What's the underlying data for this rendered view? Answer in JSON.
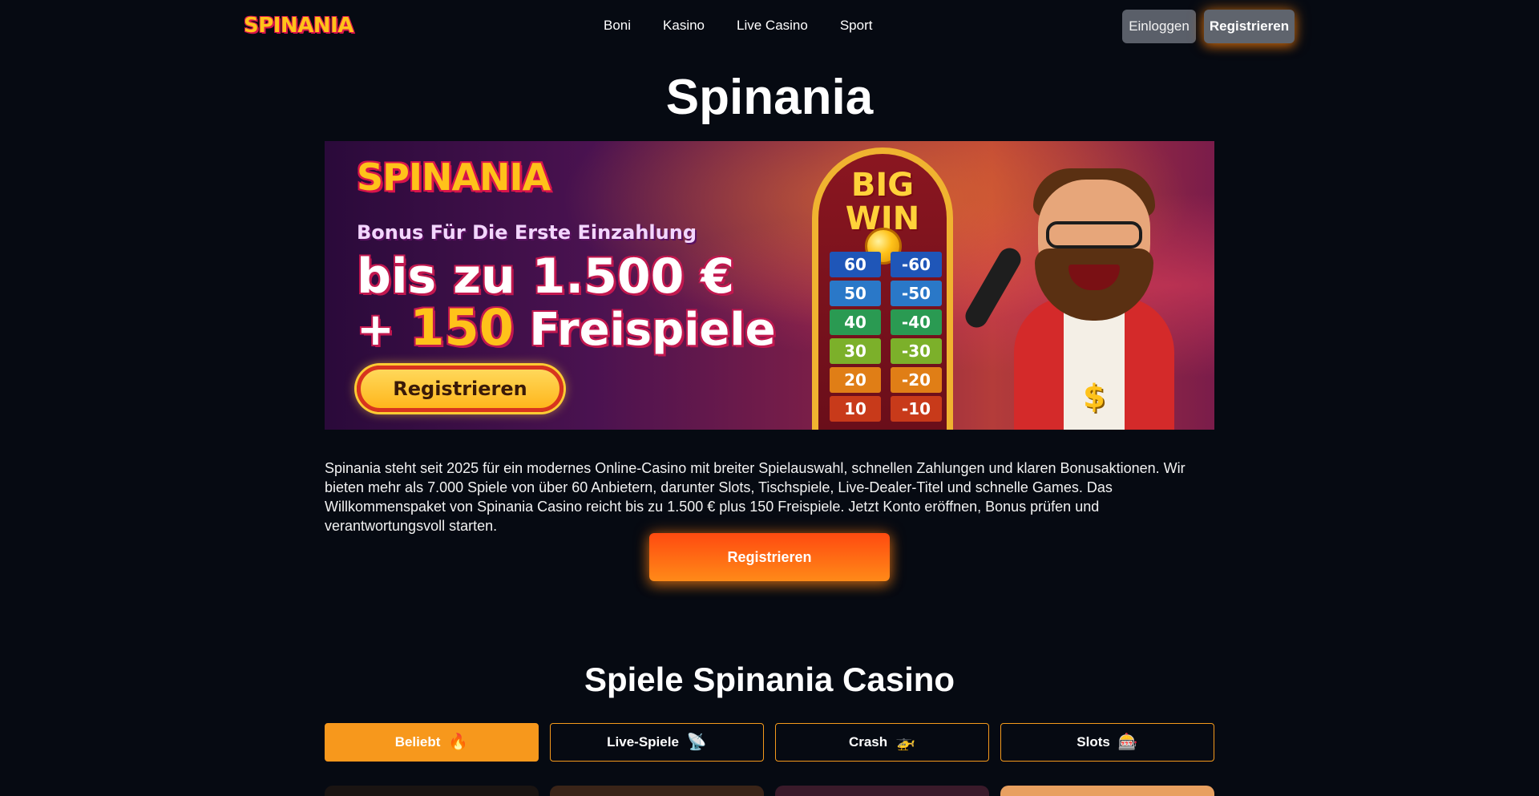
{
  "header": {
    "logo_text": "SPINANIA",
    "nav": [
      "Boni",
      "Kasino",
      "Live Casino",
      "Sport"
    ],
    "login_label": "Einloggen",
    "register_label": "Registrieren"
  },
  "hero": {
    "title": "Spinania",
    "banner": {
      "logo_text": "SPINANIA",
      "subtitle": "Bonus Für Die Erste Einzahlung",
      "amount": "bis zu 1.500 €",
      "spins_prefix": "+",
      "spins_number": "150",
      "spins_label": "Freispiele",
      "cta_label": "Registrieren",
      "machine_title_1": "BIG",
      "machine_title_2": "WIN",
      "machine_left": [
        "60",
        "50",
        "40",
        "30",
        "20",
        "10"
      ],
      "machine_right": [
        "-60",
        "-50",
        "-40",
        "-30",
        "-20",
        "-10"
      ],
      "machine_colors": [
        "#1f56b8",
        "#2a78c8",
        "#2a9a52",
        "#7cb02a",
        "#e07e16",
        "#c83a1a"
      ],
      "mascot_badge": "$"
    },
    "intro": "Spinania steht seit 2025 für ein modernes Online-Casino mit breiter Spielauswahl, schnellen Zahlungen und klaren Bonusaktionen. Wir bieten mehr als 7.000 Spiele von über 60 Anbietern, darunter Slots, Tischspiele, Live-Dealer-Titel und schnelle Games. Das Willkommenspaket von Spinania Casino reicht bis zu 1.500 € plus 150 Freispiele. Jetzt Konto eröffnen, Bonus prüfen und verantwortungsvoll starten.",
    "cta_label": "Registrieren"
  },
  "games": {
    "title": "Spiele Spinania Casino",
    "tabs": [
      {
        "label": "Beliebt",
        "icon": "fire-icon",
        "glyph": "🔥",
        "active": true
      },
      {
        "label": "Live-Spiele",
        "icon": "live-icon",
        "glyph": "📡",
        "active": false
      },
      {
        "label": "Crash",
        "icon": "helicopter-icon",
        "glyph": "🚁",
        "active": false
      },
      {
        "label": "Slots",
        "icon": "slot-machine-icon",
        "glyph": "🎰",
        "active": false
      }
    ],
    "card_colors": [
      "#1a1412",
      "#3a2418",
      "#3a1a2a",
      "#e8a060"
    ]
  },
  "colors": {
    "background": "#060a12",
    "accent_orange": "#f7981c",
    "cta_orange": "#ff5a14",
    "button_gray": "#5a5f69"
  }
}
